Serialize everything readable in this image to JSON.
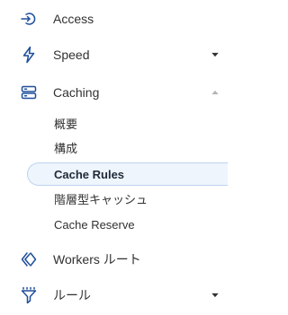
{
  "sidebar": {
    "items": [
      {
        "label": "Access",
        "icon": "access-icon",
        "expandable": false
      },
      {
        "label": "Speed",
        "icon": "lightning-icon",
        "expandable": true,
        "expanded": false
      },
      {
        "label": "Caching",
        "icon": "server-icon",
        "expandable": true,
        "expanded": true,
        "children": [
          {
            "label": "概要"
          },
          {
            "label": "構成"
          },
          {
            "label": "Cache Rules",
            "active": true
          },
          {
            "label": "階層型キャッシュ"
          },
          {
            "label": "Cache Reserve"
          }
        ]
      },
      {
        "label": "Workers ルート",
        "icon": "workers-icon",
        "expandable": false
      },
      {
        "label": "ルール",
        "icon": "funnel-icon",
        "expandable": true,
        "expanded": false
      }
    ]
  },
  "colors": {
    "icon": "#1f4e9a",
    "text": "#313131",
    "active_bg": "#eef5fd",
    "active_border": "#bcd3ef",
    "chevron": "#313131",
    "chevron_muted": "#b5b5b5"
  }
}
